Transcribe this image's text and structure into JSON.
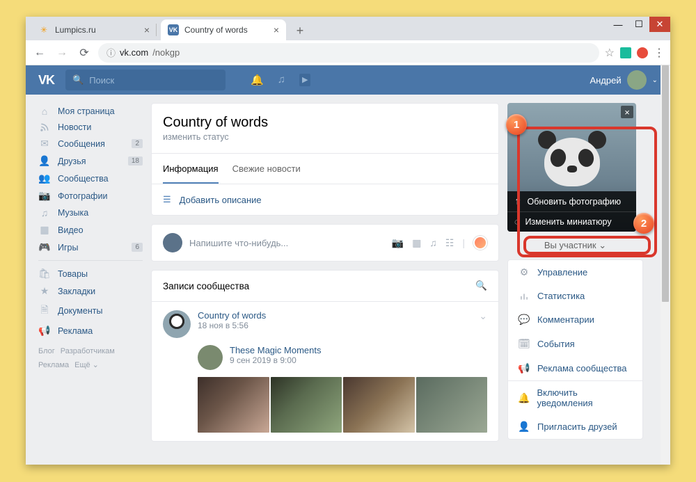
{
  "browser": {
    "tabs": [
      {
        "title": "Lumpics.ru",
        "active": false
      },
      {
        "title": "Country of words",
        "active": true
      }
    ],
    "url_host": "vk.com",
    "url_path": "/nokgp"
  },
  "vk": {
    "search_placeholder": "Поиск",
    "username": "Андрей",
    "nav": [
      {
        "icon": "🏠",
        "label": "Моя страница"
      },
      {
        "icon": "rss",
        "label": "Новости"
      },
      {
        "icon": "💬",
        "label": "Сообщения",
        "badge": "2"
      },
      {
        "icon": "👤",
        "label": "Друзья",
        "badge": "18"
      },
      {
        "icon": "👥",
        "label": "Сообщества"
      },
      {
        "icon": "📷",
        "label": "Фотографии"
      },
      {
        "icon": "🎵",
        "label": "Музыка"
      },
      {
        "icon": "🎞",
        "label": "Видео"
      },
      {
        "icon": "🎮",
        "label": "Игры",
        "badge": "6"
      }
    ],
    "nav2": [
      {
        "icon": "🛍",
        "label": "Товары"
      },
      {
        "icon": "★",
        "label": "Закладки"
      },
      {
        "icon": "📄",
        "label": "Документы"
      },
      {
        "icon": "📢",
        "label": "Реклама"
      }
    ],
    "footer": [
      "Блог",
      "Разработчикам",
      "Реклама",
      "Ещё ⌄"
    ]
  },
  "group": {
    "title": "Country of words",
    "status": "изменить статус",
    "tabs": [
      "Информация",
      "Свежие новости"
    ],
    "add_description": "Добавить описание",
    "post_placeholder": "Напишите что-нибудь...",
    "wall_header": "Записи сообщества",
    "post": {
      "name": "Country of words",
      "date": "18 ноя в 5:56",
      "repost_name": "These Magic Moments",
      "repost_date": "9 сен 2019 в 9:00"
    }
  },
  "avatar_menu": {
    "update": "Обновить фотографию",
    "thumb": "Изменить миниатюру"
  },
  "right": {
    "member": "Вы участник ⌄",
    "admin": [
      {
        "icon": "⚙",
        "label": "Управление"
      },
      {
        "icon": "stats",
        "label": "Статистика"
      },
      {
        "icon": "💬",
        "label": "Комментарии"
      },
      {
        "icon": "📅",
        "label": "События"
      },
      {
        "icon": "📢",
        "label": "Реклама сообщества"
      },
      {
        "icon": "🔔",
        "label": "Включить уведомления"
      },
      {
        "icon": "➕",
        "label": "Пригласить друзей"
      }
    ]
  },
  "annotations": {
    "a1": "1",
    "a2": "2"
  }
}
